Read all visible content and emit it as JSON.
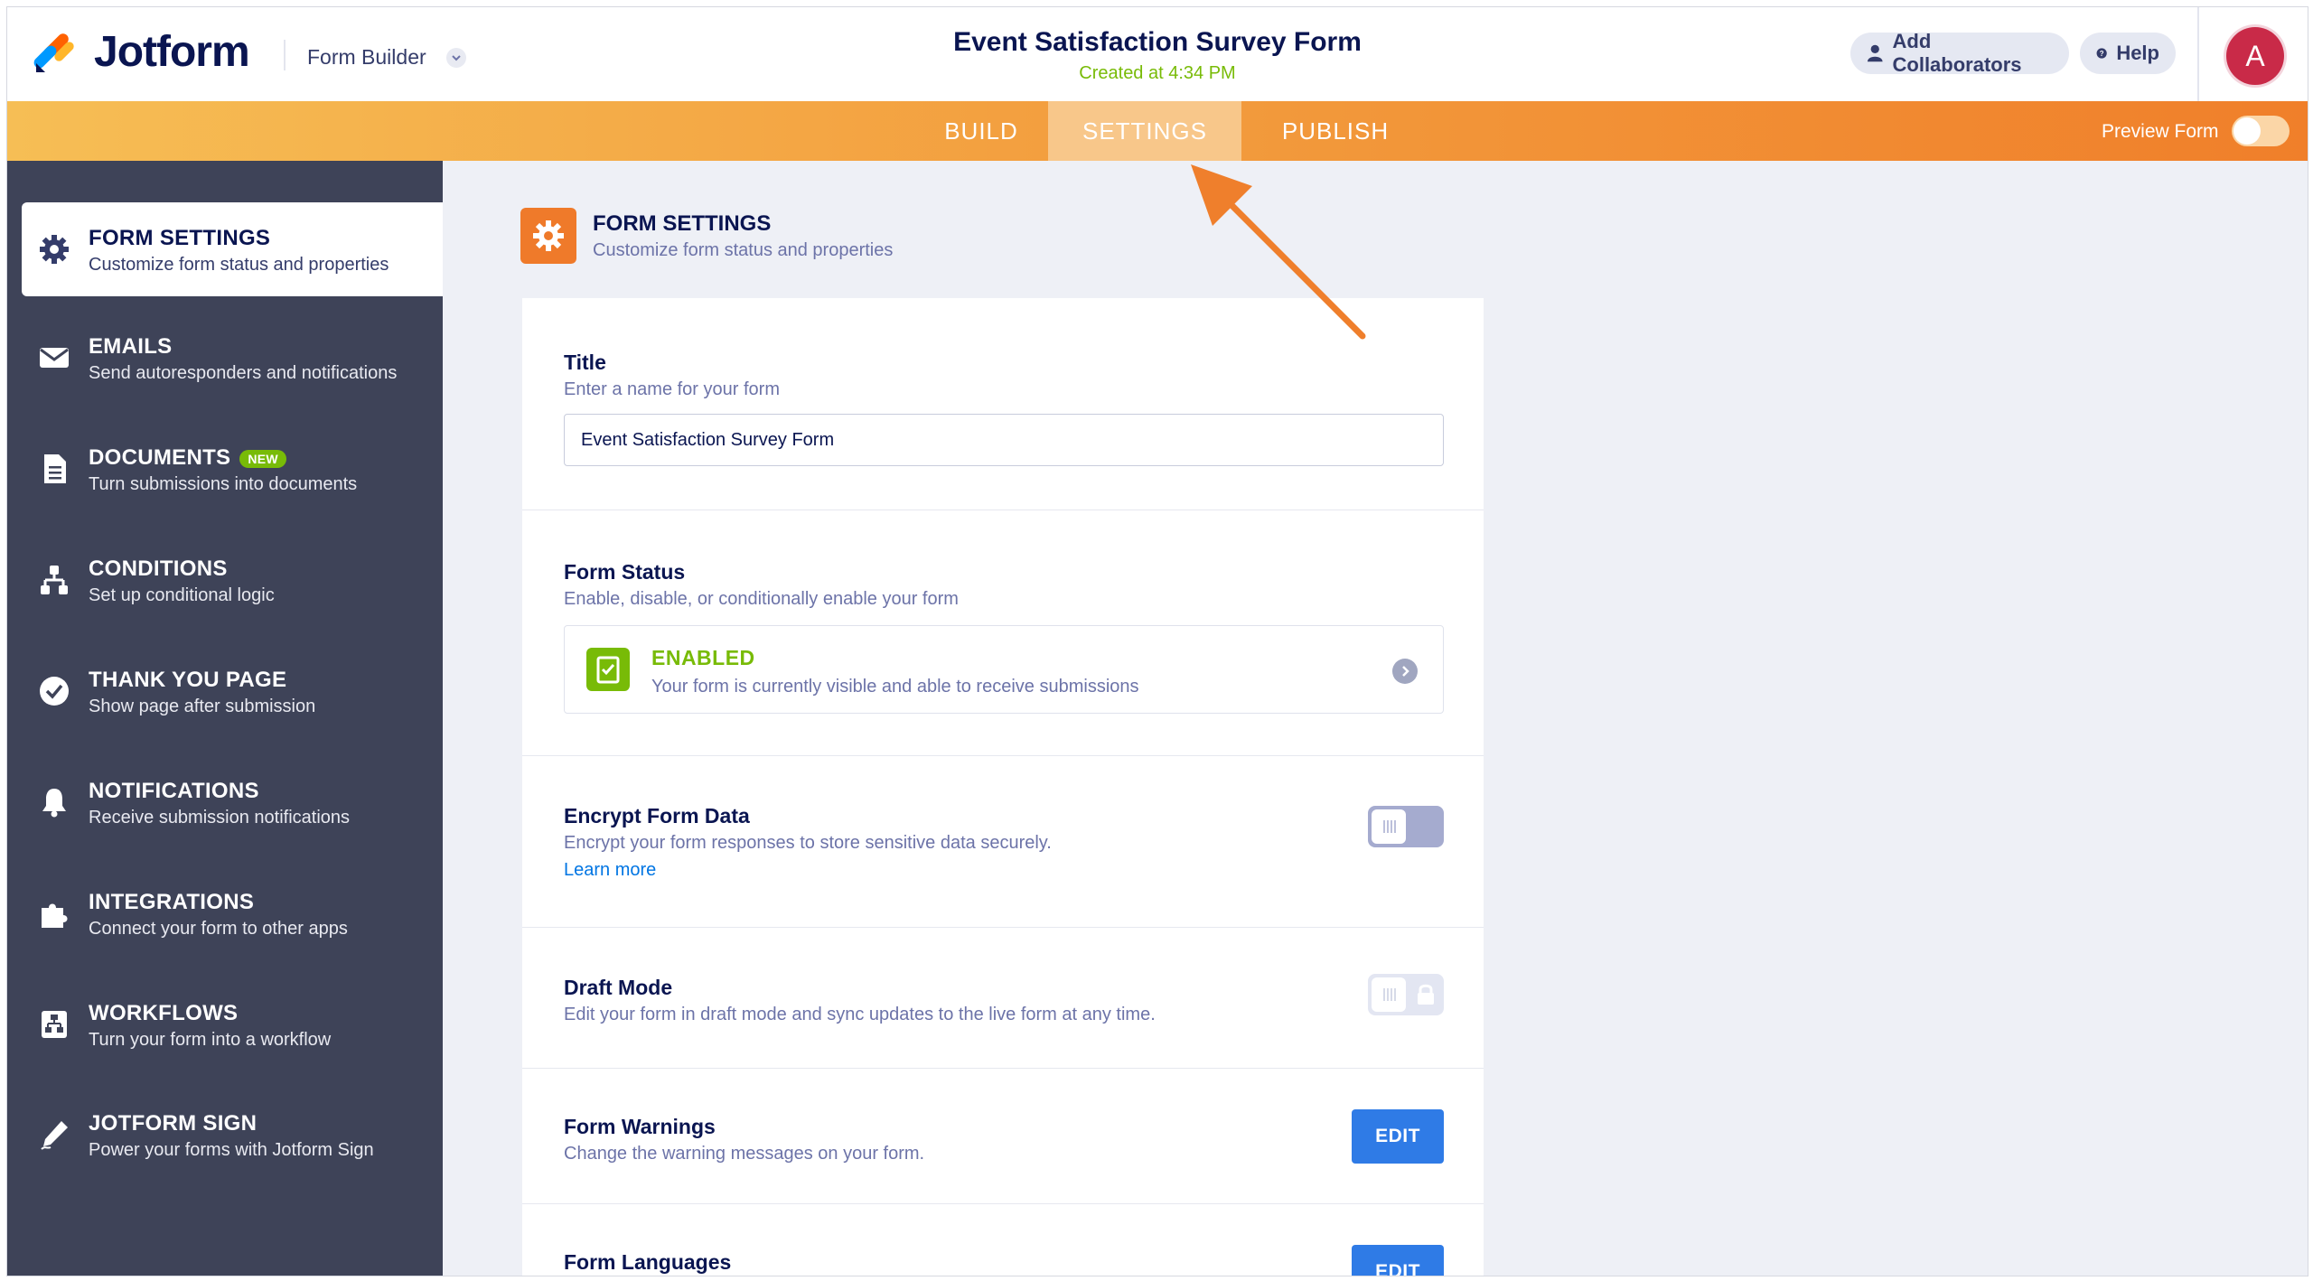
{
  "header": {
    "brand": "Jotform",
    "builder_label": "Form Builder",
    "form_title": "Event Satisfaction Survey Form",
    "created": "Created at 4:34 PM",
    "add_collaborators": "Add Collaborators",
    "help": "Help",
    "avatar_initial": "A"
  },
  "tabs": [
    {
      "label": "BUILD"
    },
    {
      "label": "SETTINGS"
    },
    {
      "label": "PUBLISH"
    }
  ],
  "preview_form": "Preview Form",
  "sidebar": {
    "items": [
      {
        "title": "FORM SETTINGS",
        "desc": "Customize form status and properties",
        "icon": "gear-icon"
      },
      {
        "title": "EMAILS",
        "desc": "Send autoresponders and notifications",
        "icon": "envelope-icon"
      },
      {
        "title": "DOCUMENTS",
        "badge": "NEW",
        "desc": "Turn submissions into documents",
        "icon": "document-icon"
      },
      {
        "title": "CONDITIONS",
        "desc": "Set up conditional logic",
        "icon": "conditions-icon"
      },
      {
        "title": "THANK YOU PAGE",
        "desc": "Show page after submission",
        "icon": "check-circle-icon"
      },
      {
        "title": "NOTIFICATIONS",
        "desc": "Receive submission notifications",
        "icon": "bell-icon"
      },
      {
        "title": "INTEGRATIONS",
        "desc": "Connect your form to other apps",
        "icon": "puzzle-icon"
      },
      {
        "title": "WORKFLOWS",
        "desc": "Turn your form into a workflow",
        "icon": "workflow-icon"
      },
      {
        "title": "JOTFORM SIGN",
        "desc": "Power your forms with Jotform Sign",
        "icon": "pen-icon"
      }
    ]
  },
  "main": {
    "head_title": "FORM SETTINGS",
    "head_desc": "Customize form status and properties",
    "title_section": {
      "title": "Title",
      "desc": "Enter a name for your form",
      "value": "Event Satisfaction Survey Form"
    },
    "status_section": {
      "title": "Form Status",
      "desc": "Enable, disable, or conditionally enable your form",
      "status": "ENABLED",
      "status_desc": "Your form is currently visible and able to receive submissions"
    },
    "encrypt_section": {
      "title": "Encrypt Form Data",
      "desc": "Encrypt your form responses to store sensitive data securely.",
      "learn_more": "Learn more"
    },
    "draft_section": {
      "title": "Draft Mode",
      "desc": "Edit your form in draft mode and sync updates to the live form at any time."
    },
    "warnings_section": {
      "title": "Form Warnings",
      "desc": "Change the warning messages on your form.",
      "button": "EDIT"
    },
    "languages_section": {
      "title": "Form Languages",
      "button": "EDIT"
    }
  },
  "colors": {
    "accent_orange": "#ef7a2a",
    "sidebar_bg": "#3e4358",
    "enabled_green": "#78bb07",
    "edit_blue": "#2f7be6"
  }
}
